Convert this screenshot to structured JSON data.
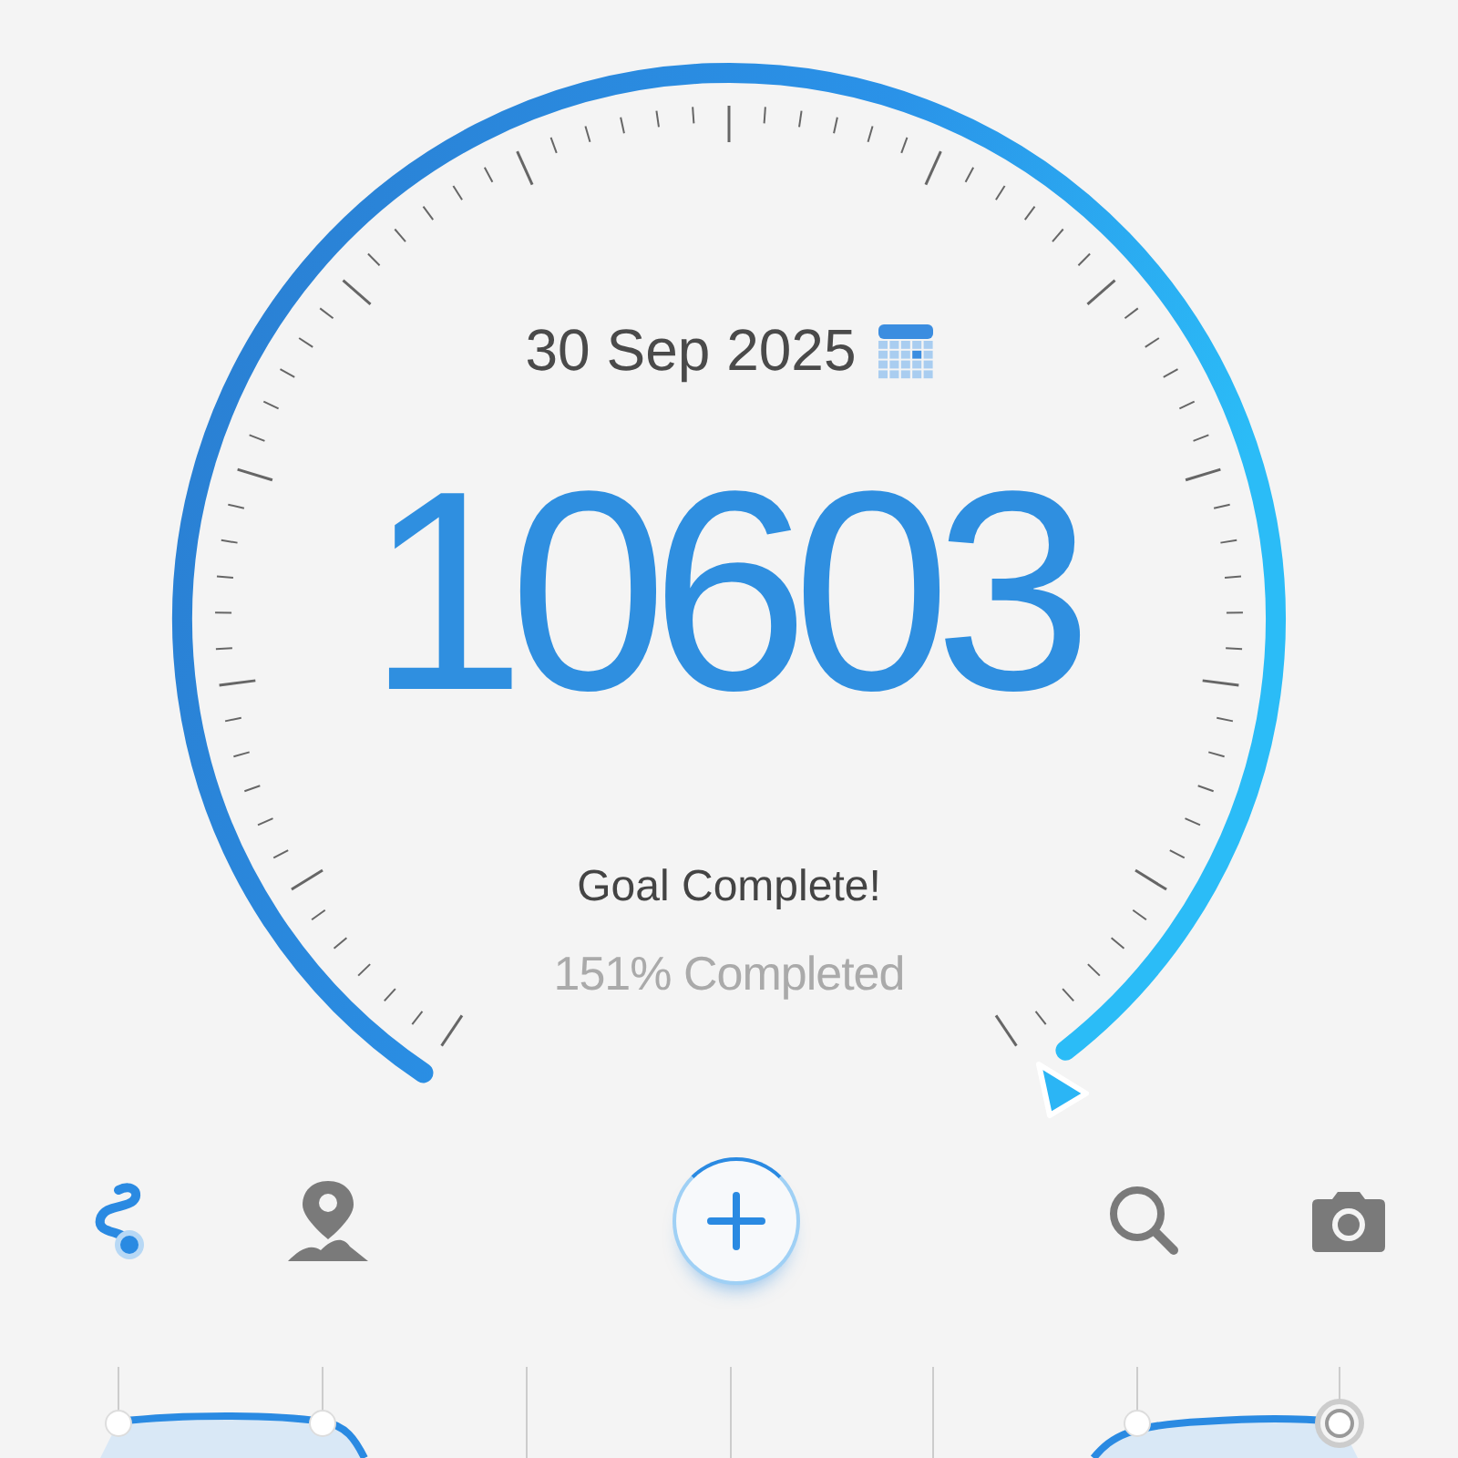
{
  "date": "30 Sep 2025",
  "steps": "10603",
  "goal_status": "Goal Complete!",
  "progress_text": "151% Completed",
  "toolbar": [
    {
      "kind": "route",
      "selected": true
    },
    {
      "kind": "map",
      "selected": false
    },
    {
      "kind": "add",
      "selected": false
    },
    {
      "kind": "search",
      "selected": false
    },
    {
      "kind": "camera",
      "selected": false
    }
  ]
}
